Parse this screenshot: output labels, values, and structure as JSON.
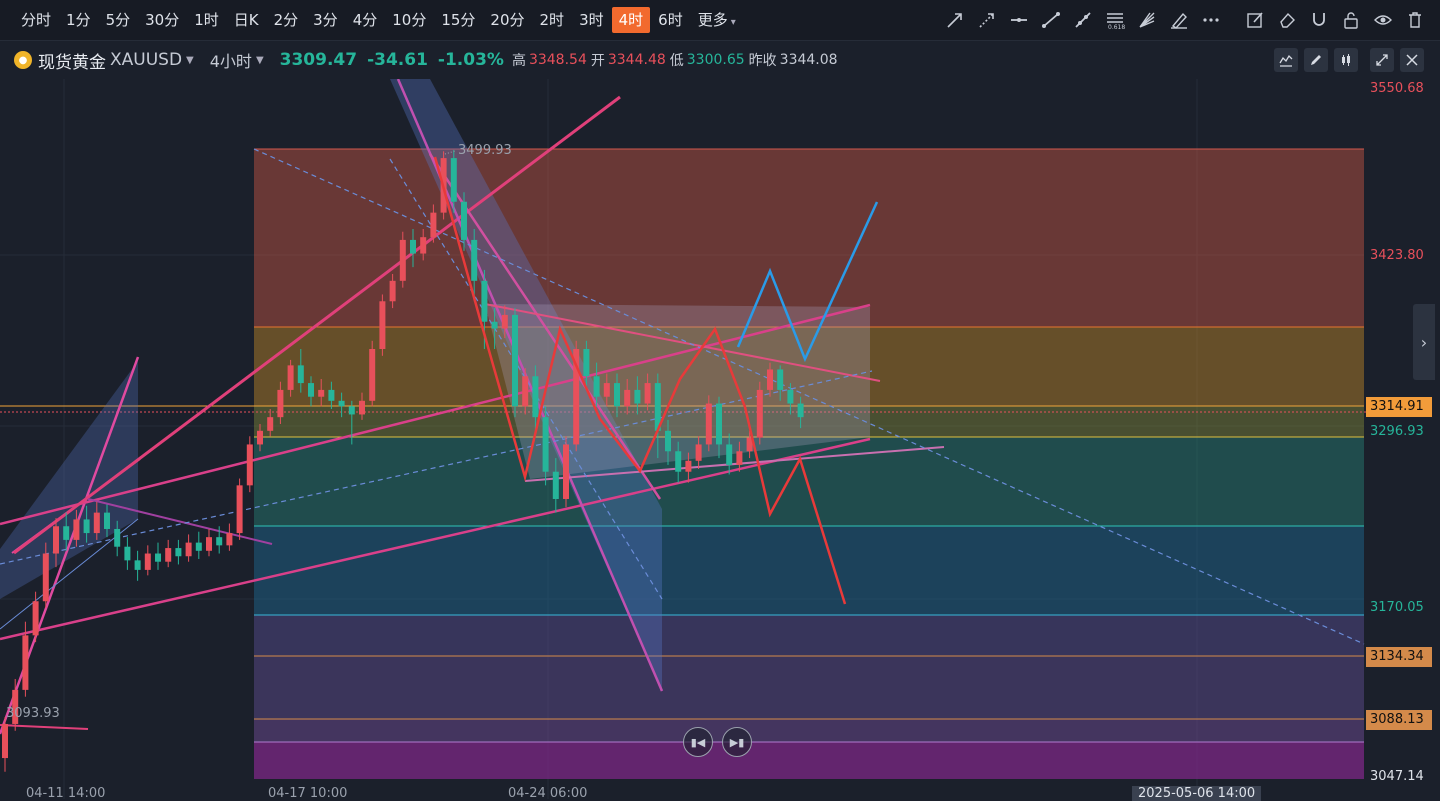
{
  "toolbar": {
    "timeframes": [
      "分时",
      "1分",
      "5分",
      "30分",
      "1时",
      "日K",
      "2分",
      "3分",
      "4分",
      "10分",
      "15分",
      "20分",
      "2时",
      "3时",
      "4时",
      "6时",
      "更多"
    ],
    "active_timeframe": "4时"
  },
  "symbol": {
    "name": "现货黄金",
    "code": "XAUUSD",
    "period": "4小时",
    "price": "3309.47",
    "change": "-34.61",
    "change_pct": "-1.03%",
    "high_label": "高",
    "high": "3348.54",
    "open_label": "开",
    "open": "3344.48",
    "low_label": "低",
    "low": "3300.65",
    "prev_close_label": "昨收",
    "prev_close": "3344.08"
  },
  "axis": {
    "levels": [
      {
        "value": "3550.68",
        "color": "#e8505b"
      },
      {
        "value": "3423.80",
        "color": "#e8505b"
      },
      {
        "value": "3296.93",
        "color": "#26b59a"
      },
      {
        "value": "3170.05",
        "color": "#26b59a"
      }
    ],
    "tags": [
      {
        "value": "3314.91",
        "bg": "#f39c3a",
        "fg": "#111"
      },
      {
        "value": "3134.34",
        "bg": "#d48a4a",
        "fg": "#111"
      },
      {
        "value": "3088.13",
        "bg": "#d48a4a",
        "fg": "#111"
      },
      {
        "value": "3047.14",
        "bg": "#1b202b",
        "fg": "#dfe3ea"
      }
    ]
  },
  "annotations": {
    "high_marker": "3499.93",
    "low_marker": "3093.93"
  },
  "dates": {
    "d1": "04-11 14:00",
    "d2": "04-17 10:00",
    "d3": "04-24 06:00",
    "cursor": "2025-05-06 14:00"
  },
  "colors": {
    "up": "#e8505b",
    "down": "#26b59a",
    "accent": "#f26a2e"
  },
  "chart_data": {
    "type": "candlestick",
    "ylim": [
      3040,
      3560
    ],
    "fib_levels": [
      3499.93,
      3423.8,
      3363.0,
      3314.91,
      3296.93,
      3245.0,
      3170.05,
      3134.34,
      3093.93
    ],
    "candles": [
      [
        3060,
        3085,
        3050,
        3090
      ],
      [
        3085,
        3110,
        3080,
        3118
      ],
      [
        3110,
        3150,
        3105,
        3160
      ],
      [
        3150,
        3175,
        3145,
        3182
      ],
      [
        3175,
        3210,
        3170,
        3218
      ],
      [
        3210,
        3230,
        3200,
        3236
      ],
      [
        3230,
        3220,
        3212,
        3240
      ],
      [
        3220,
        3235,
        3215,
        3242
      ],
      [
        3235,
        3225,
        3218,
        3245
      ],
      [
        3225,
        3240,
        3220,
        3248
      ],
      [
        3240,
        3228,
        3222,
        3246
      ],
      [
        3228,
        3215,
        3208,
        3234
      ],
      [
        3215,
        3205,
        3198,
        3222
      ],
      [
        3205,
        3198,
        3190,
        3212
      ],
      [
        3198,
        3210,
        3194,
        3216
      ],
      [
        3210,
        3204,
        3198,
        3218
      ],
      [
        3204,
        3214,
        3200,
        3220
      ],
      [
        3214,
        3208,
        3202,
        3220
      ],
      [
        3208,
        3218,
        3204,
        3224
      ],
      [
        3218,
        3212,
        3206,
        3226
      ],
      [
        3212,
        3222,
        3208,
        3228
      ],
      [
        3222,
        3216,
        3210,
        3230
      ],
      [
        3216,
        3225,
        3212,
        3232
      ],
      [
        3225,
        3260,
        3220,
        3265
      ],
      [
        3260,
        3290,
        3255,
        3296
      ],
      [
        3290,
        3300,
        3285,
        3305
      ],
      [
        3300,
        3310,
        3296,
        3316
      ],
      [
        3310,
        3330,
        3305,
        3336
      ],
      [
        3330,
        3348,
        3325,
        3352
      ],
      [
        3348,
        3335,
        3328,
        3360
      ],
      [
        3335,
        3325,
        3318,
        3340
      ],
      [
        3325,
        3330,
        3318,
        3338
      ],
      [
        3330,
        3322,
        3316,
        3336
      ],
      [
        3322,
        3318,
        3310,
        3328
      ],
      [
        3318,
        3312,
        3290,
        3322
      ],
      [
        3312,
        3322,
        3308,
        3328
      ],
      [
        3322,
        3360,
        3318,
        3366
      ],
      [
        3360,
        3395,
        3355,
        3400
      ],
      [
        3395,
        3410,
        3390,
        3415
      ],
      [
        3410,
        3440,
        3405,
        3446
      ],
      [
        3440,
        3430,
        3420,
        3448
      ],
      [
        3430,
        3442,
        3425,
        3448
      ],
      [
        3442,
        3460,
        3438,
        3466
      ],
      [
        3460,
        3500,
        3455,
        3505
      ],
      [
        3500,
        3468,
        3460,
        3506
      ],
      [
        3468,
        3440,
        3432,
        3475
      ],
      [
        3440,
        3410,
        3395,
        3448
      ],
      [
        3410,
        3380,
        3360,
        3418
      ],
      [
        3380,
        3375,
        3360,
        3390
      ],
      [
        3375,
        3385,
        3368,
        3392
      ],
      [
        3385,
        3318,
        3310,
        3390
      ],
      [
        3318,
        3340,
        3312,
        3346
      ],
      [
        3340,
        3310,
        3300,
        3348
      ],
      [
        3310,
        3270,
        3260,
        3318
      ],
      [
        3270,
        3250,
        3240,
        3280
      ],
      [
        3250,
        3290,
        3244,
        3296
      ],
      [
        3290,
        3360,
        3285,
        3366
      ],
      [
        3360,
        3340,
        3330,
        3366
      ],
      [
        3340,
        3325,
        3318,
        3350
      ],
      [
        3325,
        3335,
        3318,
        3342
      ],
      [
        3335,
        3318,
        3310,
        3342
      ],
      [
        3318,
        3330,
        3312,
        3338
      ],
      [
        3330,
        3320,
        3312,
        3340
      ],
      [
        3320,
        3335,
        3315,
        3342
      ],
      [
        3335,
        3300,
        3280,
        3342
      ],
      [
        3300,
        3285,
        3275,
        3308
      ],
      [
        3285,
        3270,
        3262,
        3292
      ],
      [
        3270,
        3278,
        3262,
        3284
      ],
      [
        3278,
        3290,
        3272,
        3296
      ],
      [
        3290,
        3320,
        3285,
        3326
      ],
      [
        3320,
        3290,
        3280,
        3325
      ],
      [
        3290,
        3275,
        3268,
        3298
      ],
      [
        3275,
        3285,
        3270,
        3292
      ],
      [
        3285,
        3295,
        3280,
        3300
      ],
      [
        3295,
        3330,
        3290,
        3336
      ],
      [
        3330,
        3345,
        3325,
        3350
      ],
      [
        3345,
        3330,
        3322,
        3348
      ],
      [
        3330,
        3320,
        3312,
        3335
      ],
      [
        3320,
        3310,
        3302,
        3325
      ]
    ]
  }
}
